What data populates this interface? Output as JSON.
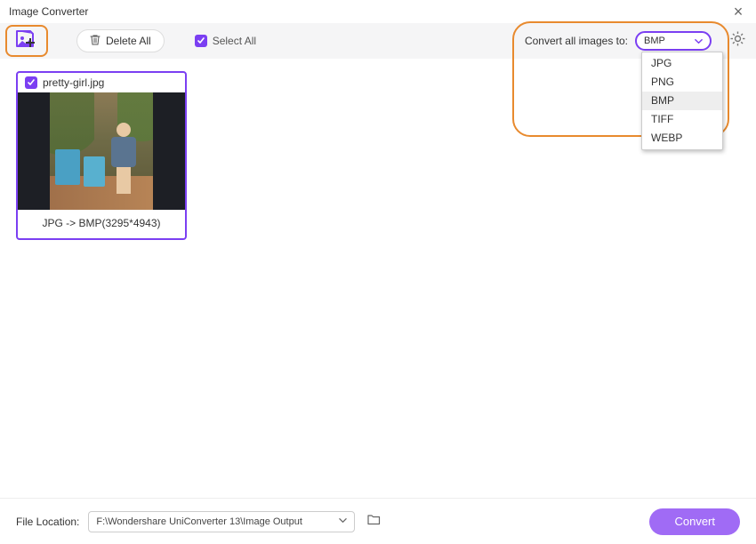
{
  "window": {
    "title": "Image Converter"
  },
  "toolbar": {
    "delete_all": "Delete All",
    "select_all": "Select All",
    "convert_label": "Convert all images to:",
    "selected_format": "BMP"
  },
  "format_options": [
    "JPG",
    "PNG",
    "BMP",
    "TIFF",
    "WEBP"
  ],
  "format_selected_index": 2,
  "thumbnails": [
    {
      "filename": "pretty-girl.jpg",
      "caption": "JPG -> BMP(3295*4943)",
      "checked": true
    }
  ],
  "footer": {
    "label": "File Location:",
    "path": "F:\\Wondershare UniConverter 13\\Image Output",
    "convert": "Convert"
  },
  "colors": {
    "accent": "#7b3ff2",
    "highlight": "#e88a2e"
  }
}
